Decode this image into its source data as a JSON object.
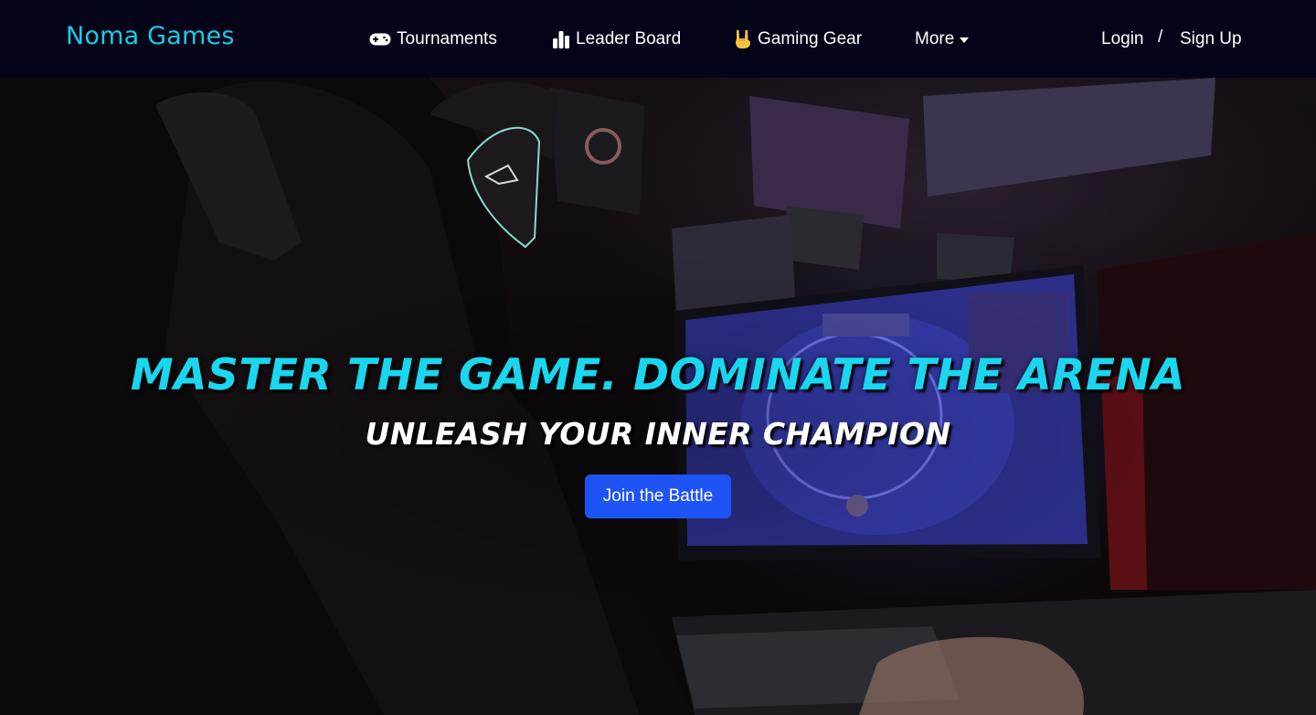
{
  "navbar": {
    "brand": "Noma Games",
    "items": [
      {
        "label": "Tournaments",
        "icon": "gamepad-icon"
      },
      {
        "label": "Leader Board",
        "icon": "bar-chart-icon"
      },
      {
        "label": "Gaming Gear",
        "icon": "rock-hand-icon"
      },
      {
        "label": "More",
        "icon": "caret-down-icon"
      }
    ],
    "auth": {
      "login": "Login",
      "separator": "/",
      "signup": "Sign Up"
    }
  },
  "hero": {
    "headline": "MASTER THE GAME. DOMINATE THE ARENA",
    "subheadline": "UNLEASH YOUR INNER CHAMPION",
    "cta_label": "Join the Battle"
  },
  "colors": {
    "navbar_bg": "#040419",
    "brand": "#1ecbe1",
    "headline": "#1ad6ee",
    "cta_bg": "#1e54f5"
  }
}
